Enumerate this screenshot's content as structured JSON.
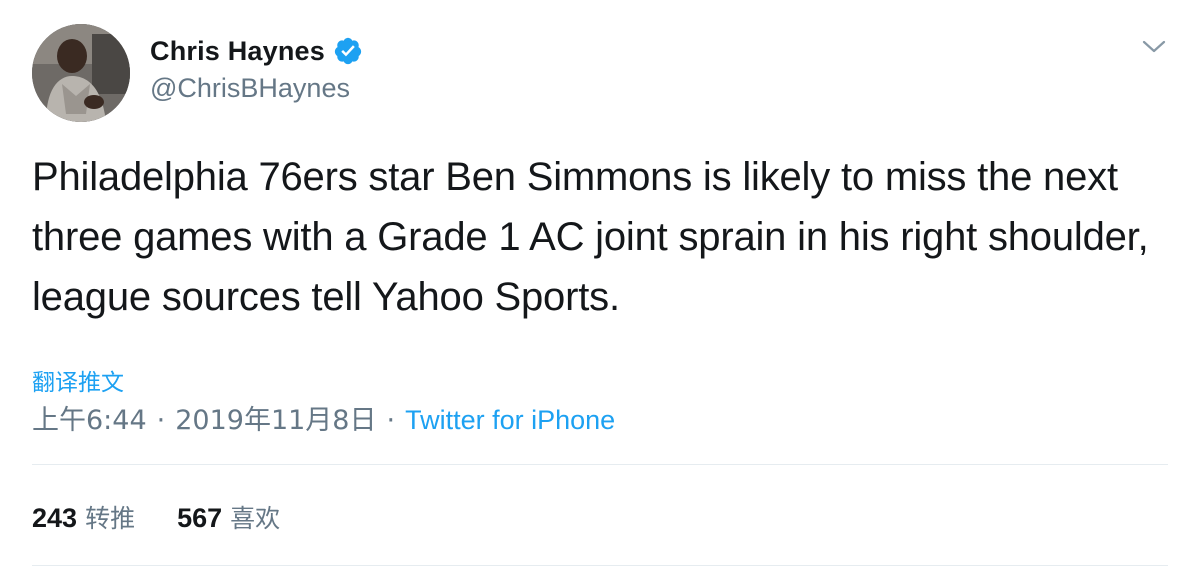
{
  "user": {
    "display_name": "Chris Haynes",
    "handle": "@ChrisBHaynes",
    "verified": true
  },
  "icons": {
    "verified": "verified-badge-icon",
    "caret": "chevron-down-icon"
  },
  "colors": {
    "link": "#1da1f2",
    "secondary_text": "#657786",
    "primary_text": "#14171a",
    "divider": "#e6ecf0"
  },
  "tweet": {
    "text": "Philadelphia 76ers star Ben Simmons is likely to miss the next three games with a Grade 1 AC joint sprain in his right shoulder, league sources tell Yahoo Sports.",
    "translate_label": "翻译推文",
    "time": "上午6:44",
    "date": "2019年11月8日",
    "separator": "·",
    "source": "Twitter for iPhone"
  },
  "stats": {
    "retweets_count": "243",
    "retweets_label": "转推",
    "likes_count": "567",
    "likes_label": "喜欢"
  }
}
